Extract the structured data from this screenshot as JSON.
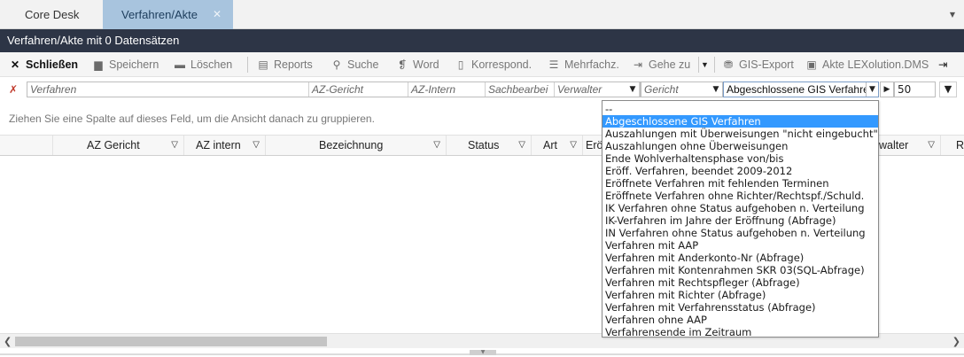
{
  "tabs": [
    {
      "label": "Core Desk",
      "active": false
    },
    {
      "label": "Verfahren/Akte",
      "active": true,
      "close": "✕"
    }
  ],
  "title_bar": "Verfahren/Akte mit 0 Datensätzen",
  "toolbar": {
    "close": "Schließen",
    "save": "Speichern",
    "delete": "Löschen",
    "reports": "Reports",
    "search": "Suche",
    "word": "Word",
    "korrespond": "Korrespond.",
    "mehrfachz": "Mehrfachz.",
    "gehe_zu": "Gehe zu",
    "gis_export": "GIS-Export",
    "akte_lex": "Akte LEXolution.DMS"
  },
  "filter": {
    "verfahren": "Verfahren",
    "az_gericht": "AZ-Gericht",
    "az_intern": "AZ-Intern",
    "sachbearbeiter": "Sachbearbei",
    "verwalter": "Verwalter",
    "gericht": "Gericht",
    "query_value": "Abgeschlossene GIS Verfahren",
    "page_size": "50"
  },
  "group_hint": "Ziehen Sie eine Spalte auf dieses Feld, um die Ansicht danach zu gruppieren.",
  "columns": [
    "AZ Gericht",
    "AZ intern",
    "Bezeichnung",
    "Status",
    "Art",
    "Erö",
    "walter",
    "R"
  ],
  "dropdown_items": [
    "--",
    "Abgeschlossene GIS Verfahren",
    "Auszahlungen mit Überweisungen \"nicht eingebucht\"",
    "Auszahlungen ohne Überweisungen",
    "Ende Wohlverhaltensphase von/bis",
    "Eröff. Verfahren, beendet 2009-2012",
    "Eröffnete Verfahren mit fehlenden Terminen",
    "Eröffnete Verfahren ohne Richter/Rechtspf./Schuld.",
    "IK Verfahren ohne Status aufgehoben n. Verteilung",
    "IK-Verfahren im Jahre der Eröffnung (Abfrage)",
    "IN Verfahren ohne Status aufgehoben n. Verteilung",
    "Verfahren mit AAP",
    "Verfahren mit Anderkonto-Nr (Abfrage)",
    "Verfahren mit Kontenrahmen SKR 03(SQL-Abfrage)",
    "Verfahren mit Rechtspfleger (Abfrage)",
    "Verfahren mit Richter (Abfrage)",
    "Verfahren mit Verfahrensstatus (Abfrage)",
    "Verfahren ohne AAP",
    "Verfahrensende im Zeitraum"
  ],
  "selected_index": 1,
  "colors": {
    "title_bg": "#2d3546",
    "active_tab": "#a8c4de",
    "selection": "#3399ff"
  }
}
